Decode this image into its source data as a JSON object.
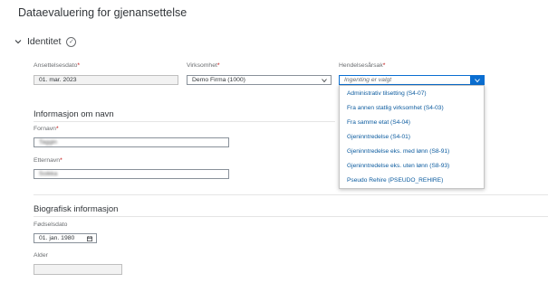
{
  "header": {
    "title": "Dataevaluering for gjenansettelse"
  },
  "identity_section": {
    "title": "Identitet",
    "hire_date": {
      "label": "Ansettelsesdato",
      "value": "01. mar. 2023"
    },
    "company": {
      "label": "Virksomhet",
      "value": "Demo Firma (1000)"
    },
    "event_reason": {
      "label": "Hendelsesårsak",
      "placeholder": "Ingenting er valgt"
    }
  },
  "event_reason_options": [
    "Administrativ tilsetting (S4-07)",
    "Fra annen statlig virksomhet (S4-03)",
    "Fra samme etat (S4-04)",
    "Gjeninntredelse (S4-01)",
    "Gjeninntredelse eks. med lønn (S8-91)",
    "Gjeninntredelse eks. uten lønn (S8-93)",
    "Pseudo Rehire (PSEUDO_REHIRE)"
  ],
  "name_section": {
    "title": "Informasjon om navn",
    "first_name": {
      "label": "Fornavn",
      "value": "Taggin"
    },
    "last_name": {
      "label": "Etternavn",
      "value": "Soikka"
    }
  },
  "bio_section": {
    "title": "Biografisk informasjon",
    "birth_date": {
      "label": "Fødselsdato",
      "value": "01. jan. 1980"
    },
    "age": {
      "label": "Alder",
      "value": ""
    }
  },
  "required_marker": "*",
  "colors": {
    "accent": "#0a6ed1",
    "link": "#0a5a9e",
    "required": "#bb0000"
  }
}
